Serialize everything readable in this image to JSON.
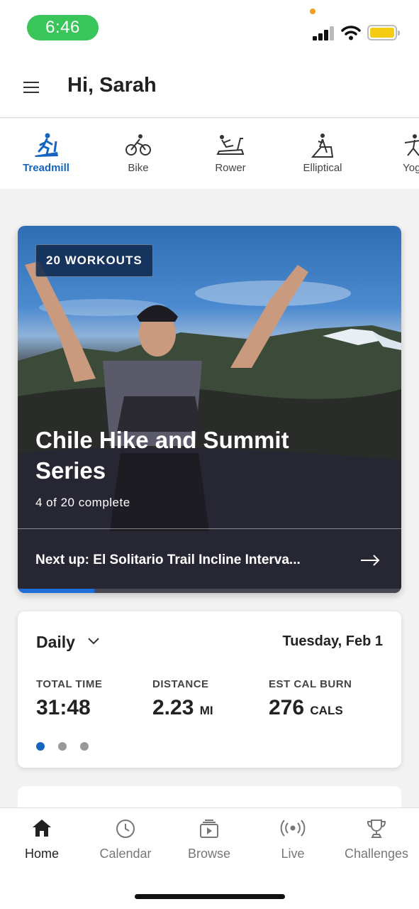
{
  "status": {
    "time": "6:46"
  },
  "header": {
    "greeting": "Hi, Sarah",
    "menu_icon": "hamburger-icon"
  },
  "equipment": [
    {
      "label": "Treadmill",
      "icon": "treadmill-icon",
      "active": true
    },
    {
      "label": "Bike",
      "icon": "bike-icon",
      "active": false
    },
    {
      "label": "Rower",
      "icon": "rower-icon",
      "active": false
    },
    {
      "label": "Elliptical",
      "icon": "elliptical-icon",
      "active": false
    },
    {
      "label": "Yoga",
      "icon": "yoga-icon",
      "active": false
    }
  ],
  "hero": {
    "badge": "20 WORKOUTS",
    "title": "Chile Hike and Summit Series",
    "progress_text": "4 of 20 complete",
    "progress_fraction": 0.2,
    "next_up": "Next up: El Solitario Trail Incline Interva...",
    "arrow_icon": "arrow-right-icon"
  },
  "stats": {
    "period": "Daily",
    "date": "Tuesday, Feb 1",
    "items": [
      {
        "label": "TOTAL TIME",
        "value": "31:48",
        "unit": ""
      },
      {
        "label": "DISTANCE",
        "value": "2.23",
        "unit": "MI"
      },
      {
        "label": "EST CAL BURN",
        "value": "276",
        "unit": "CALS"
      }
    ],
    "page_count": 3,
    "active_page": 1
  },
  "nav": [
    {
      "label": "Home",
      "icon": "home-icon",
      "active": true
    },
    {
      "label": "Calendar",
      "icon": "clock-icon",
      "active": false
    },
    {
      "label": "Browse",
      "icon": "browse-icon",
      "active": false
    },
    {
      "label": "Live",
      "icon": "live-broadcast-icon",
      "active": false
    },
    {
      "label": "Challenges",
      "icon": "trophy-icon",
      "active": false
    }
  ],
  "colors": {
    "accent": "#1565c0",
    "status_green": "#3ac55a",
    "battery": "#f5cc14"
  }
}
